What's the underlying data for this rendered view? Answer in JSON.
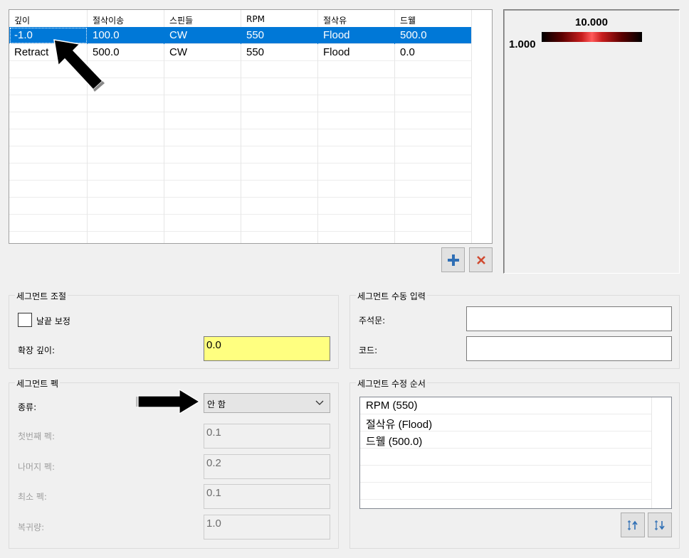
{
  "grid": {
    "headers": [
      "깊이",
      "절삭이송",
      "스핀들",
      "RPM",
      "절삭유",
      "드웰"
    ],
    "rows": [
      [
        "-1.0",
        "100.0",
        "CW",
        "550",
        "Flood",
        "500.0"
      ],
      [
        "Retract",
        "500.0",
        "CW",
        "550",
        "Flood",
        "0.0"
      ]
    ],
    "selected_row": 0,
    "add_icon": "plus-icon",
    "delete_icon": "close-icon"
  },
  "preview": {
    "max_value": "10.000",
    "min_value": "1.000"
  },
  "segment_adjust": {
    "title": "세그먼트 조절",
    "checkbox_label": "날끝 보정",
    "checkbox_checked": false,
    "extend_depth_label": "확장 깊이:",
    "extend_depth_value": "0.0"
  },
  "segment_manual": {
    "title": "세그먼트 수동 입력",
    "comment_label": "주석문:",
    "comment_value": "",
    "code_label": "코드:",
    "code_value": ""
  },
  "segment_peck": {
    "title": "세그먼트 펙",
    "type_label": "종류:",
    "type_value": "안 함",
    "first_peck_label": "첫번째 펙:",
    "first_peck_value": "0.1",
    "rest_peck_label": "나머지 펙:",
    "rest_peck_value": "0.2",
    "min_peck_label": "최소 펙:",
    "min_peck_value": "0.1",
    "retract_label": "복귀량:",
    "retract_value": "1.0"
  },
  "segment_order": {
    "title": "세그먼트 수정 순서",
    "items": [
      "RPM (550)",
      "절삭유 (Flood)",
      "드웰 (500.0)"
    ]
  },
  "colors": {
    "selection": "#0078d7",
    "highlight_field": "#ffff80",
    "delete_red": "#d04a30",
    "add_blue": "#2f6fb5"
  }
}
